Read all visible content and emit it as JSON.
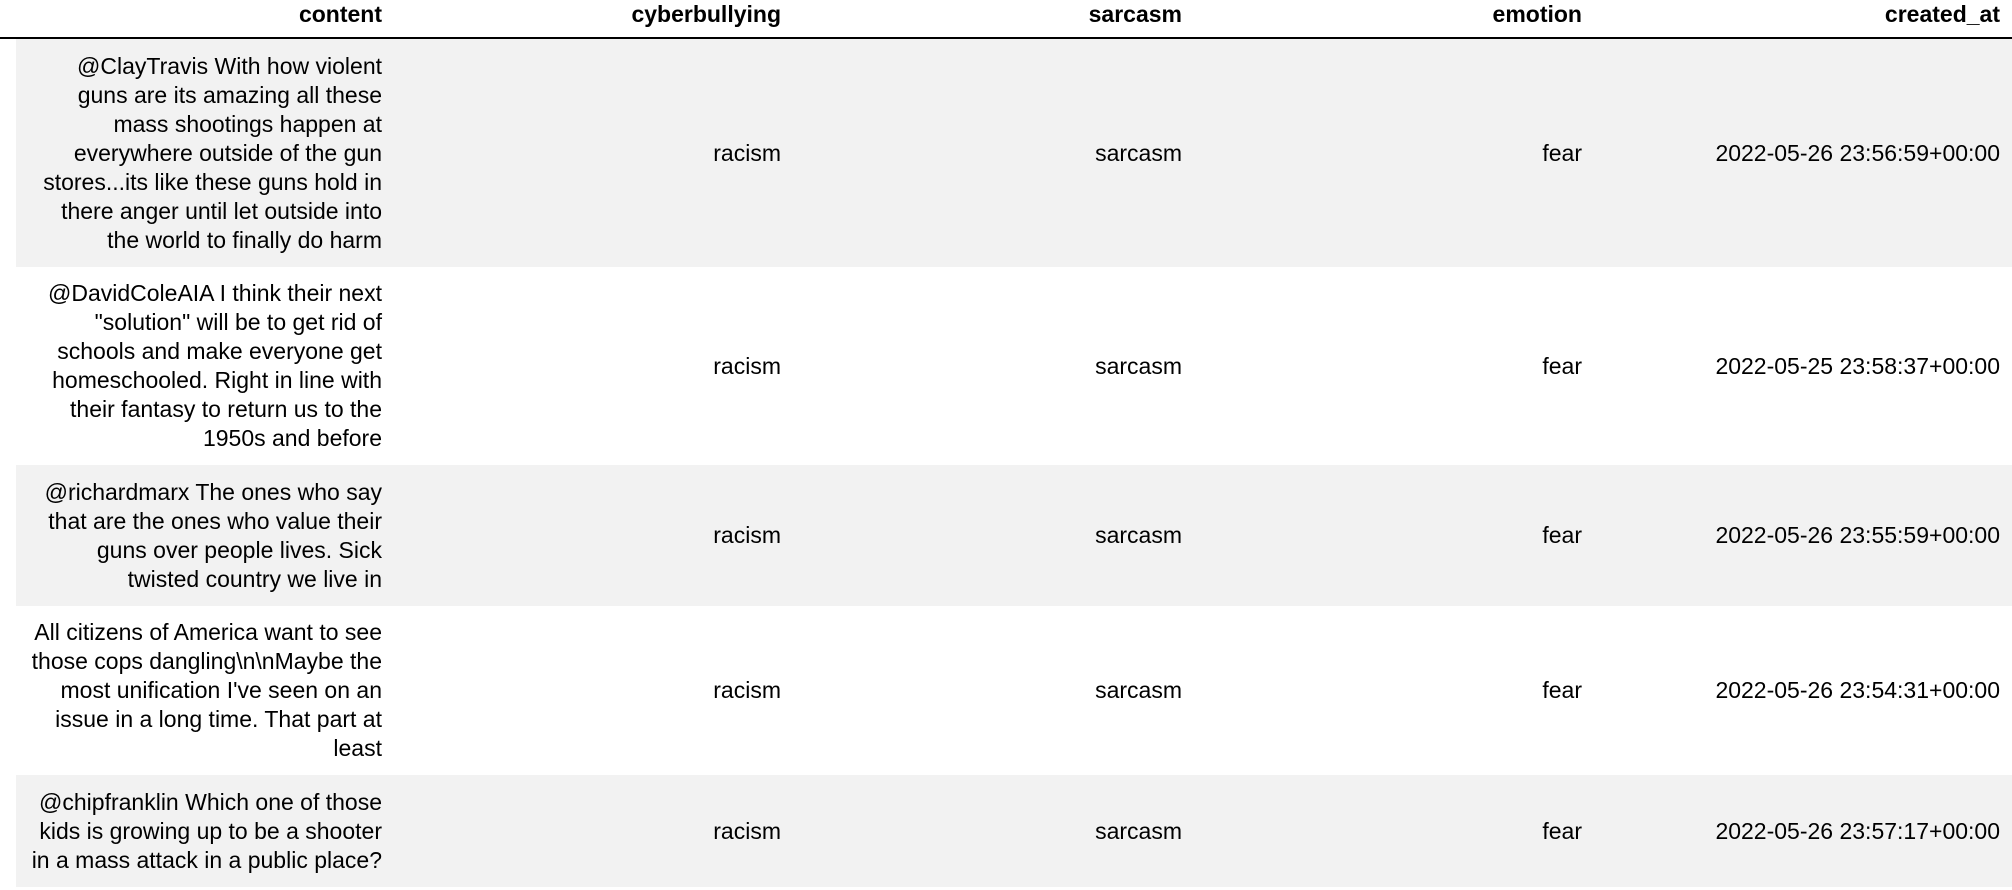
{
  "table": {
    "columns": [
      "content",
      "cyberbullying",
      "sarcasm",
      "emotion",
      "created_at"
    ],
    "rows": [
      {
        "content": "@ClayTravis With how violent guns are its amazing all these mass shootings happen at everywhere outside of the gun stores...its like these guns hold in there anger until let outside into the world to finally do harm",
        "cyberbullying": "racism",
        "sarcasm": "sarcasm",
        "emotion": "fear",
        "created_at": "2022-05-26 23:56:59+00:00"
      },
      {
        "content": "@DavidColeAIA I think their next \"solution\" will be to get rid of schools and make everyone get homeschooled. Right in line with their fantasy to return us to the 1950s and before",
        "cyberbullying": "racism",
        "sarcasm": "sarcasm",
        "emotion": "fear",
        "created_at": "2022-05-25 23:58:37+00:00"
      },
      {
        "content": "@richardmarx The ones who say that are the ones who value their guns over people lives. Sick twisted country we live in",
        "cyberbullying": "racism",
        "sarcasm": "sarcasm",
        "emotion": "fear",
        "created_at": "2022-05-26 23:55:59+00:00"
      },
      {
        "content": "All citizens of America want to see those cops dangling\\n\\nMaybe the most unification I've seen on an issue in a long time. That part at least",
        "cyberbullying": "racism",
        "sarcasm": "sarcasm",
        "emotion": "fear",
        "created_at": "2022-05-26 23:54:31+00:00"
      },
      {
        "content": "@chipfranklin Which one of those kids is growing up to be a shooter in a mass attack in a public place?",
        "cyberbullying": "racism",
        "sarcasm": "sarcasm",
        "emotion": "fear",
        "created_at": "2022-05-26 23:57:17+00:00"
      }
    ]
  }
}
